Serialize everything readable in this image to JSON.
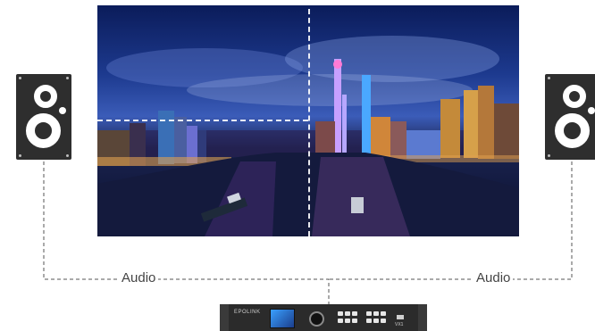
{
  "labels": {
    "audio_left": "Audio",
    "audio_right": "Audio"
  },
  "controller": {
    "brand": "EPOLINK",
    "model": "VX1"
  },
  "icons": {
    "speaker_left": "speaker-icon",
    "speaker_right": "speaker-icon",
    "controller": "video-processor-icon"
  },
  "colors": {
    "speaker": "#2e2e2e",
    "connector_line": "#555555",
    "divider": "#ffffff"
  }
}
